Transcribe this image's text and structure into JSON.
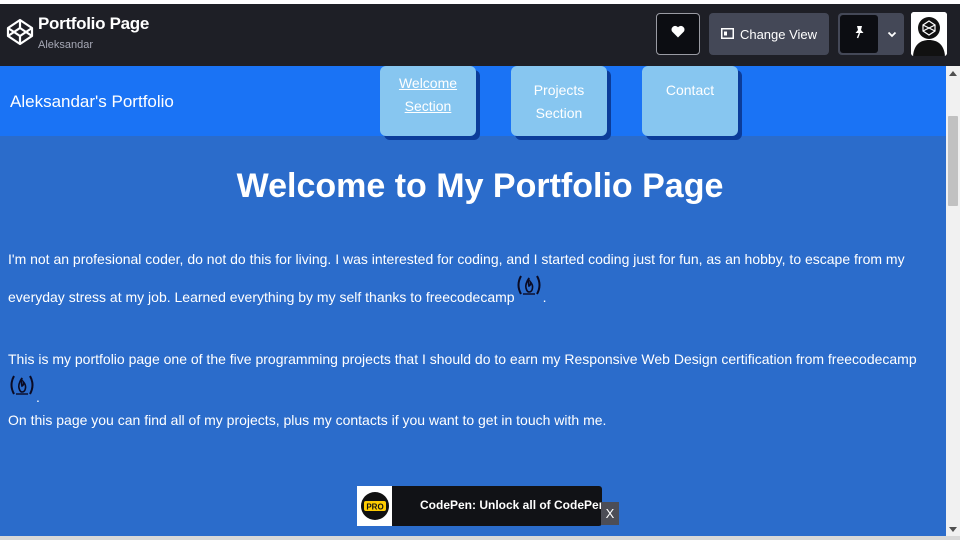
{
  "header": {
    "title": "Portfolio Page",
    "author": "Aleksandar",
    "change_view_label": "Change View",
    "logo_icon": "codepen-logo-icon",
    "heart_icon": "heart-icon",
    "view_icon": "layout-view-icon",
    "pin_icon": "pin-icon",
    "dropdown_icon": "chevron-down-icon",
    "avatar_icon": "user-avatar"
  },
  "site": {
    "brand": "Aleksandar's Portfolio",
    "nav": [
      {
        "line1": "Welcome",
        "line2": "Section",
        "active": true
      },
      {
        "line1": "Projects",
        "line2": "Section",
        "active": false
      },
      {
        "line1": "Contact",
        "line2": "",
        "active": false
      }
    ],
    "hero_title": "Welcome to My Portfolio Page",
    "paragraphs": [
      {
        "text": "I'm not an profesional coder, do not do this for living. I was interested for coding, and I started coding just for fun, as an hobby, to escape from my everyday stress at my job. Learned everything by my self thanks to freecodecamp",
        "suffix": "."
      },
      {
        "text": "This is my portfolio page one of the five programming projects that I should do to earn my Responsive Web Design certification from freecodecamp",
        "suffix": "."
      },
      {
        "text": "On this page you can find all of my projects, plus my contacts if you want to get in touch with me.",
        "suffix": ""
      }
    ],
    "fcc_icon": "freecodecamp-icon"
  },
  "promo": {
    "badge": "PRO",
    "text": "CodePen: Unlock all of CodePen",
    "close": "X"
  },
  "colors": {
    "header_bg": "#1e1f26",
    "nav_bg": "#1a73f5",
    "page_bg": "#2b6ccb",
    "nav_button": "#87c6f0",
    "nav_button_shadow": "#0b3c9a",
    "pro_badge": "#ffcc00"
  }
}
